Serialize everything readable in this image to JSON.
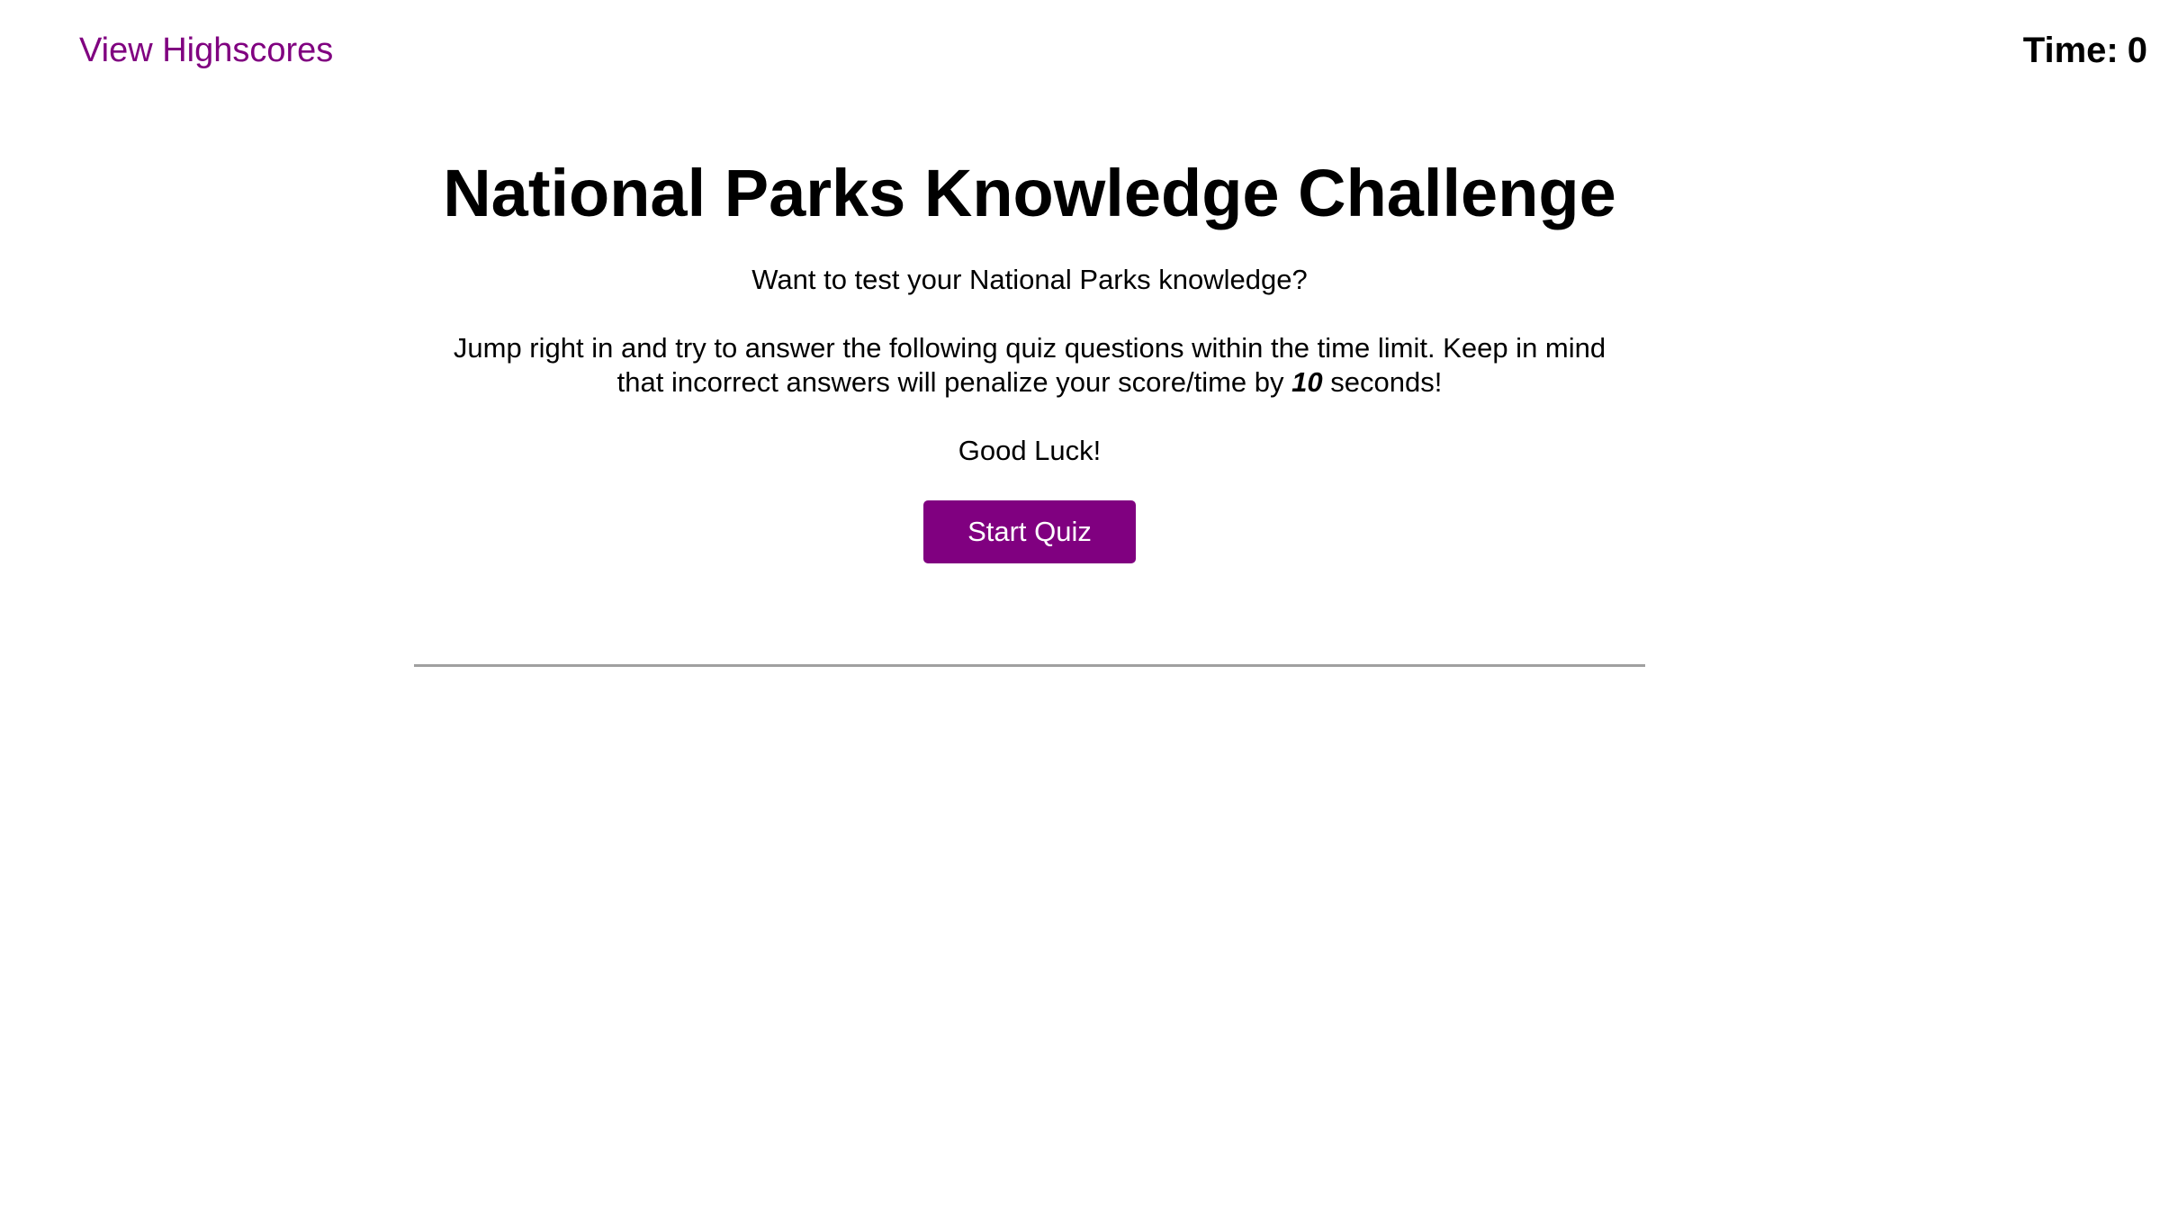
{
  "header": {
    "highscores_link": "View Highscores",
    "timer_label": "Time:",
    "timer_value": "0"
  },
  "main": {
    "title": "National Parks Knowledge Challenge",
    "intro": "Want to test your National Parks knowledge?",
    "instructions_part1": "Jump right in and try to answer the following quiz questions within the time limit. Keep in mind that incorrect answers will penalize your score/time by",
    "penalty_seconds": "10",
    "instructions_part2": "seconds!",
    "good_luck": "Good Luck!",
    "start_button": "Start Quiz"
  },
  "colors": {
    "accent": "#800080",
    "divider": "#a0a0a0"
  }
}
